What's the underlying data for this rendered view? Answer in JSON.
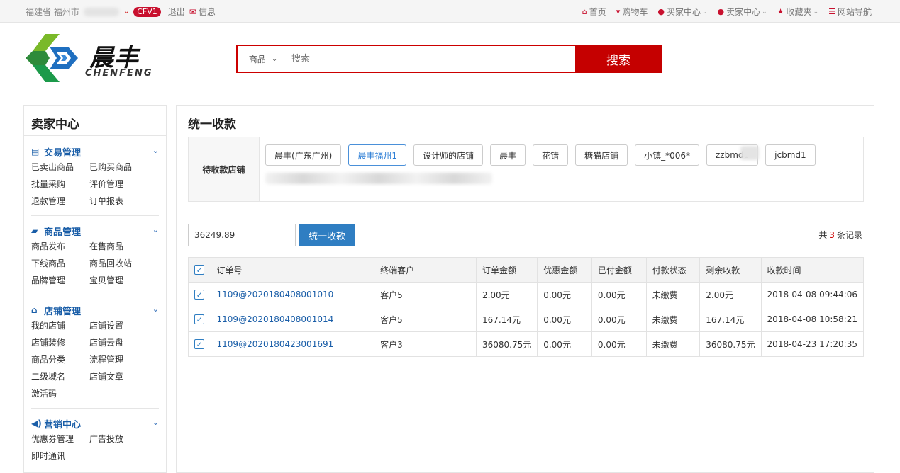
{
  "topbar": {
    "location": "福建省 福州市",
    "badge": "CFV1",
    "logout": "退出",
    "message": "信息",
    "links": [
      {
        "label": "首页",
        "icon": "home-icon"
      },
      {
        "label": "购物车",
        "icon": "cart-icon"
      },
      {
        "label": "买家中心",
        "icon": "user-icon",
        "dropdown": true
      },
      {
        "label": "卖家中心",
        "icon": "user-icon",
        "dropdown": true
      },
      {
        "label": "收藏夹",
        "icon": "star-icon",
        "dropdown": true
      },
      {
        "label": "网站导航",
        "icon": "list-icon"
      }
    ]
  },
  "logo": {
    "cn": "晨丰",
    "en": "CHENFENG"
  },
  "search": {
    "category": "商品",
    "placeholder": "搜索",
    "button": "搜索"
  },
  "sidebar": {
    "title": "卖家中心",
    "groups": [
      {
        "title": "交易管理",
        "icon": "list-icon",
        "items": [
          "已卖出商品",
          "已购买商品",
          "批量采购",
          "评价管理",
          "退款管理",
          "订单报表"
        ]
      },
      {
        "title": "商品管理",
        "icon": "truck-icon",
        "items": [
          "商品发布",
          "在售商品",
          "下线商品",
          "商品回收站",
          "品牌管理",
          "宝贝管理"
        ]
      },
      {
        "title": "店铺管理",
        "icon": "home-icon",
        "items": [
          "我的店铺",
          "店铺设置",
          "店铺装修",
          "店铺云盘",
          "商品分类",
          "流程管理",
          "二级域名",
          "店铺文章",
          "激活码"
        ]
      },
      {
        "title": "营销中心",
        "icon": "volume-icon",
        "items": [
          "优惠券管理",
          "广告投放",
          "即时通讯"
        ]
      }
    ]
  },
  "main": {
    "title": "统一收款",
    "shops_label": "待收款店铺",
    "shops": [
      {
        "label": "晨丰(广东广州)",
        "active": false
      },
      {
        "label": "晨丰福州1",
        "active": true
      },
      {
        "label": "设计师的店铺",
        "active": false
      },
      {
        "label": "晨丰",
        "active": false
      },
      {
        "label": "花错",
        "active": false
      },
      {
        "label": "糖猫店铺",
        "active": false
      },
      {
        "label": "小镇_*006*",
        "active": false
      },
      {
        "label": "zzbmd1",
        "active": false
      },
      {
        "label": "jcbmd1",
        "active": false
      }
    ],
    "amount": "36249.89",
    "pay_button": "统一收款",
    "records": {
      "prefix": "共",
      "count": "3",
      "suffix": "条记录"
    },
    "table": {
      "headers": [
        "订单号",
        "终端客户",
        "订单金额",
        "优惠金额",
        "已付金额",
        "付款状态",
        "剩余收款",
        "收款时间"
      ],
      "rows": [
        [
          "1109@2020180408001010",
          "客户5",
          "2.00元",
          "0.00元",
          "0.00元",
          "未缴费",
          "2.00元",
          "2018-04-08 09:44:06"
        ],
        [
          "1109@2020180408001014",
          "客户5",
          "167.14元",
          "0.00元",
          "0.00元",
          "未缴费",
          "167.14元",
          "2018-04-08 10:58:21"
        ],
        [
          "1109@2020180423001691",
          "客户3",
          "36080.75元",
          "0.00元",
          "0.00元",
          "未缴费",
          "36080.75元",
          "2018-04-23 17:20:35"
        ]
      ]
    }
  },
  "colors": {
    "brand_red": "#c50000",
    "link_blue": "#1a5ea8",
    "primary_blue": "#2f7ec2"
  }
}
